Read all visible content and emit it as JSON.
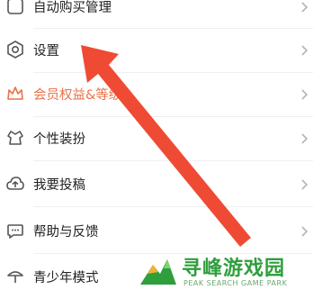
{
  "menu": {
    "items": [
      {
        "label": "自动购买管理",
        "icon": "auto-buy-icon"
      },
      {
        "label": "设置",
        "icon": "settings-icon"
      },
      {
        "label": "会员权益&等级",
        "icon": "crown-icon"
      },
      {
        "label": "个性装扮",
        "icon": "personalization-icon"
      },
      {
        "label": "我要投稿",
        "icon": "upload-icon"
      },
      {
        "label": "帮助与反馈",
        "icon": "help-feedback-icon"
      },
      {
        "label": "青少年模式",
        "icon": "youth-mode-icon"
      }
    ]
  },
  "watermark": {
    "title": "寻峰游戏园",
    "subtitle": "PEAK SEARCH GAME PARK"
  },
  "colors": {
    "accent_text": "#e8734a",
    "arrow": "#ef4b34",
    "watermark_green": "#2f9e3c"
  }
}
